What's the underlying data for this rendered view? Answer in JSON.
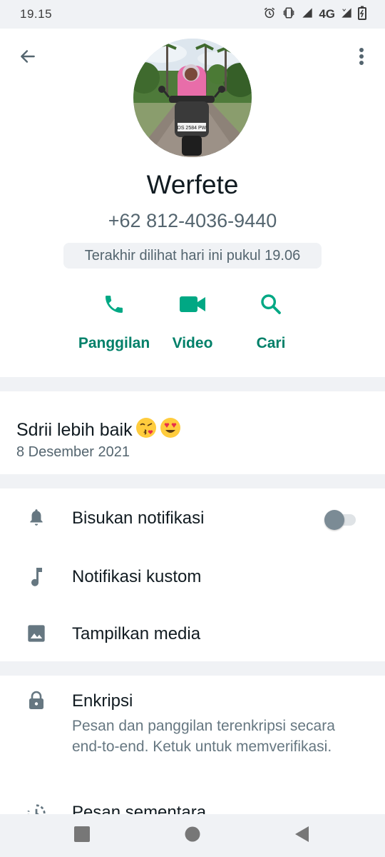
{
  "status_bar": {
    "time": "19.15",
    "network": "4G",
    "icons": [
      "alarm-icon",
      "vibrate-icon",
      "signal-icon",
      "battery-icon"
    ]
  },
  "header": {
    "back_icon": "arrow-left-icon",
    "menu_icon": "more-vertical-icon",
    "name": "Werfete",
    "phone": "+62 812-4036-9440",
    "last_seen": "Terakhir dilihat hari ini pukul 19.06",
    "plate_text": "DS 2584 PW"
  },
  "actions": [
    {
      "label": "Panggilan",
      "icon": "phone-icon"
    },
    {
      "label": "Video",
      "icon": "video-icon"
    },
    {
      "label": "Cari",
      "icon": "search-icon"
    }
  ],
  "about": {
    "text": "Sdrii lebih baik",
    "emojis": [
      "face-blowing-kiss",
      "heart-eyes"
    ],
    "date": "8 Desember 2021"
  },
  "settings": {
    "items": [
      {
        "label": "Bisukan notifikasi",
        "icon": "bell-icon",
        "toggle": false
      },
      {
        "label": "Notifikasi kustom",
        "icon": "music-note-icon"
      },
      {
        "label": "Tampilkan media",
        "icon": "image-icon"
      }
    ]
  },
  "security": {
    "title": "Enkripsi",
    "description": "Pesan dan panggilan terenkripsi secara end-to-end. Ketuk untuk memverifikasi.",
    "icon": "lock-icon",
    "next_label": "Pesan sementara",
    "next_icon": "timer-icon"
  },
  "nav": {
    "items": [
      "recents-icon",
      "home-icon",
      "back-icon"
    ]
  },
  "colors": {
    "accent": "#008069",
    "accent_icon": "#00a884",
    "icon_gray": "#667781",
    "background": "#f0f2f5"
  }
}
